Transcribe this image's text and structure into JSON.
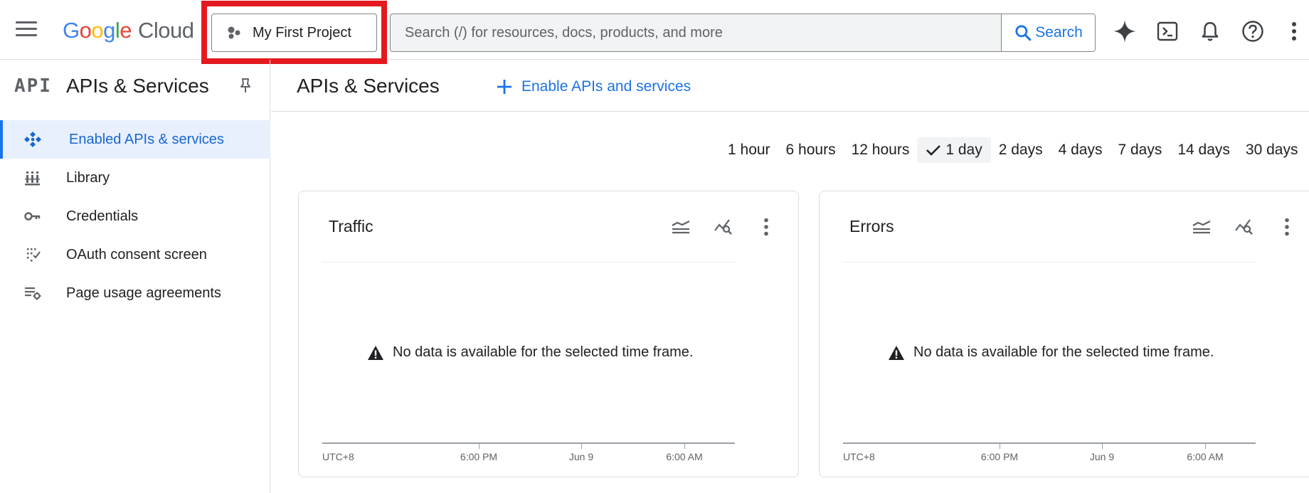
{
  "header": {
    "menu_icon": "hamburger-menu-icon",
    "logo": {
      "letters": [
        "G",
        "o",
        "o",
        "g",
        "l",
        "e"
      ],
      "product": "Cloud"
    },
    "project_selector": {
      "label": "My First Project",
      "icon": "project-dots-icon"
    },
    "search": {
      "placeholder": "Search (/) for resources, docs, products, and more",
      "button_label": "Search"
    },
    "icons": [
      "gemini-sparkle-icon",
      "cloud-shell-terminal-icon",
      "notifications-bell-icon",
      "help-icon",
      "more-vert-icon"
    ]
  },
  "sidebar": {
    "logo_text": "API",
    "title": "APIs & Services",
    "items": [
      {
        "label": "Enabled APIs & services",
        "icon": "enabled-apis-icon",
        "active": true
      },
      {
        "label": "Library",
        "icon": "library-icon",
        "active": false
      },
      {
        "label": "Credentials",
        "icon": "key-icon",
        "active": false
      },
      {
        "label": "OAuth consent screen",
        "icon": "oauth-consent-icon",
        "active": false
      },
      {
        "label": "Page usage agreements",
        "icon": "page-usage-settings-icon",
        "active": false
      }
    ]
  },
  "main": {
    "title": "APIs & Services",
    "enable_button": "Enable APIs and services",
    "time_range": {
      "options": [
        "1 hour",
        "6 hours",
        "12 hours",
        "1 day",
        "2 days",
        "4 days",
        "7 days",
        "14 days",
        "30 days"
      ],
      "selected": "1 day"
    },
    "cards": [
      {
        "title": "Traffic",
        "no_data_message": "No data is available for the selected time frame.",
        "axis_labels": [
          "UTC+8",
          "6:00 PM",
          "Jun 9",
          "6:00 AM"
        ]
      },
      {
        "title": "Errors",
        "no_data_message": "No data is available for the selected time frame.",
        "axis_labels": [
          "UTC+8",
          "6:00 PM",
          "Jun 9",
          "6:00 AM"
        ]
      }
    ]
  },
  "colors": {
    "accent": "#1a73e8",
    "highlight": "#e3191f",
    "active_bg": "#e8f0fe"
  }
}
